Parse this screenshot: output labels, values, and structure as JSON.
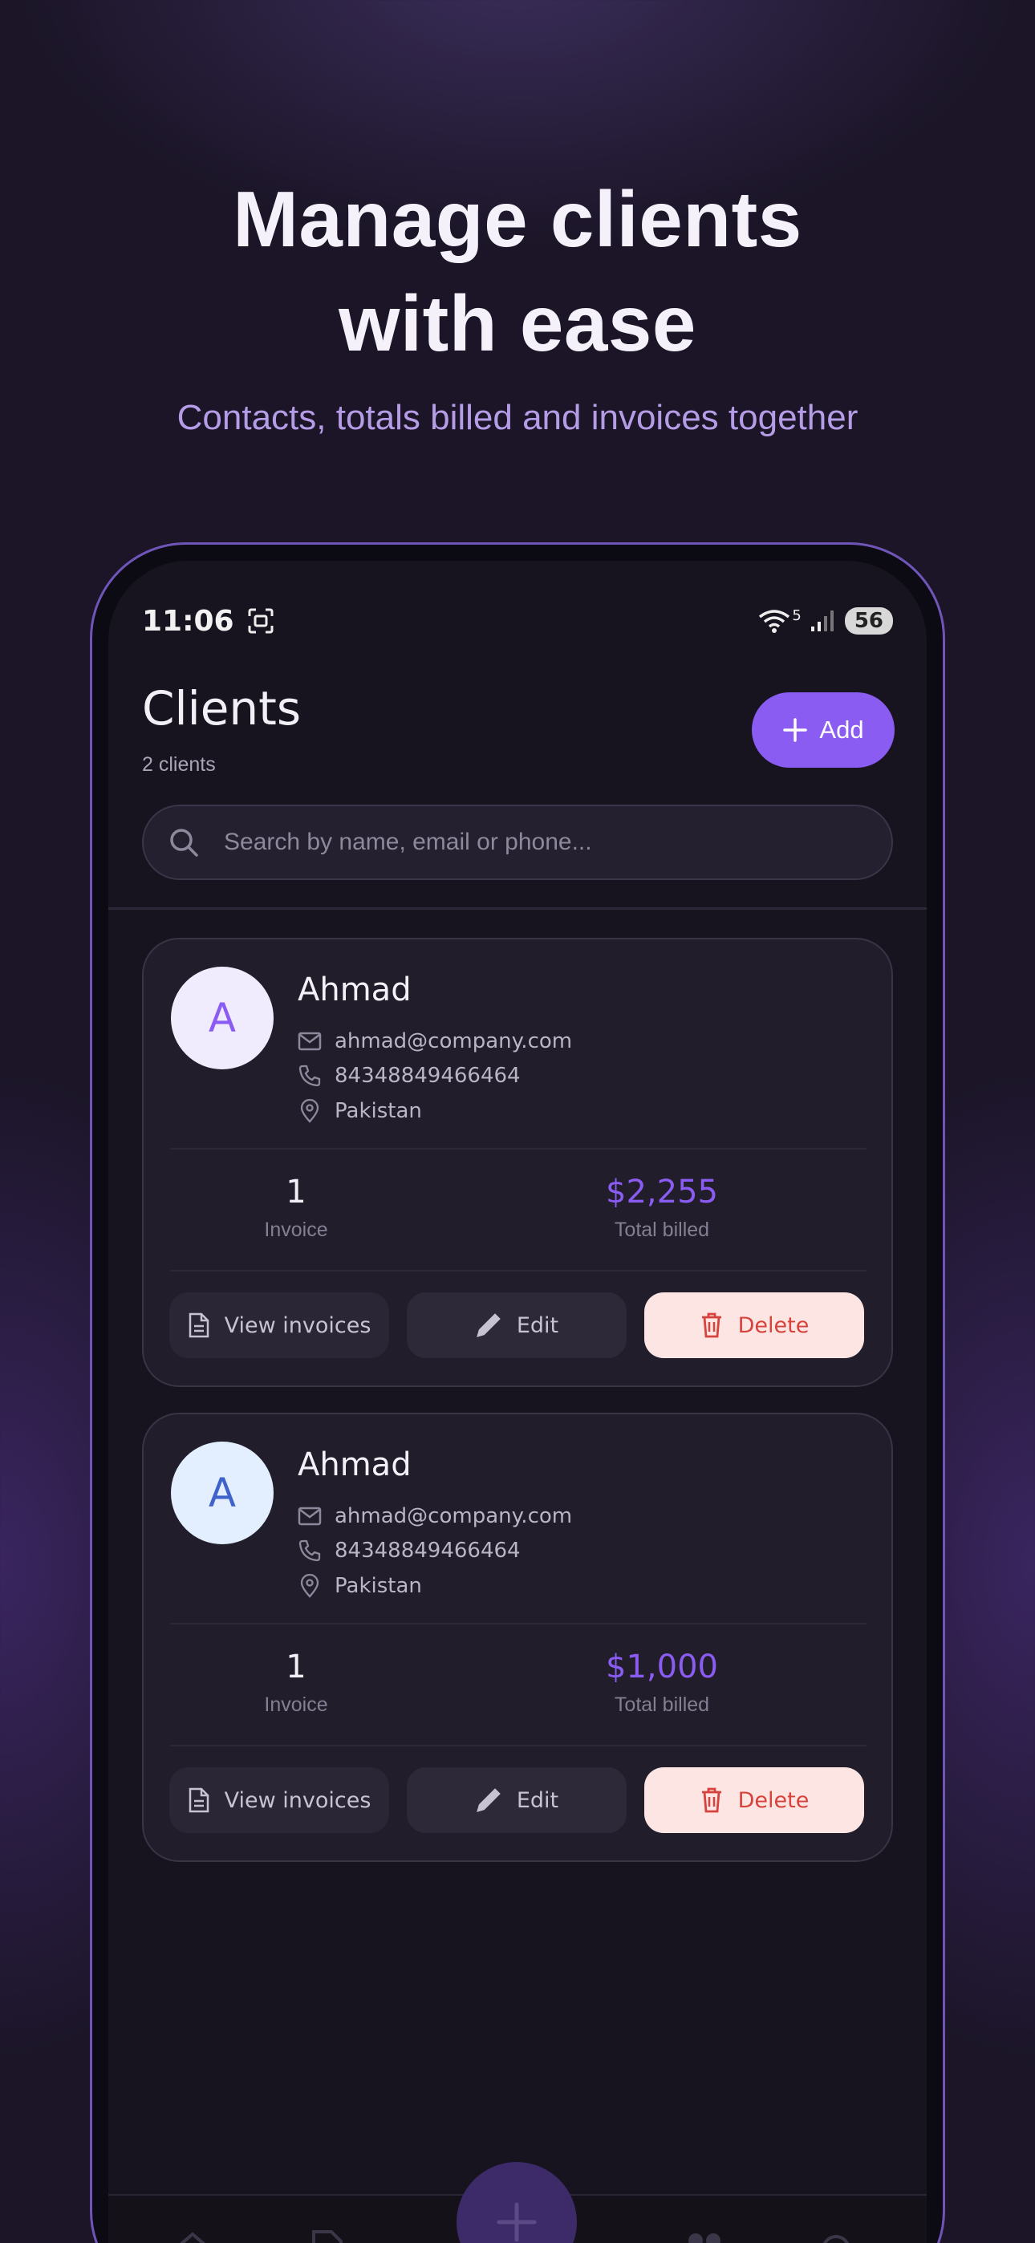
{
  "hero": {
    "title_line1": "Manage clients",
    "title_line2": "with ease",
    "subtitle": "Contacts, totals billed and invoices together"
  },
  "status_bar": {
    "time": "11:06",
    "battery": "56",
    "wifi_badge": "5"
  },
  "header": {
    "title": "Clients",
    "count": "2 clients",
    "add_label": "Add"
  },
  "search": {
    "placeholder": "Search by name, email or phone..."
  },
  "clients": [
    {
      "initial": "A",
      "name": "Ahmad",
      "email": "ahmad@company.com",
      "phone": "84348849466464",
      "country": "Pakistan",
      "invoice_count": "1",
      "invoice_label": "Invoice",
      "total_billed": "$2,255",
      "total_label": "Total billed",
      "avatar_bg": "#f1ecfd",
      "avatar_fg": "#8a5cf2"
    },
    {
      "initial": "A",
      "name": "Ahmad",
      "email": "ahmad@company.com",
      "phone": "84348849466464",
      "country": "Pakistan",
      "invoice_count": "1",
      "invoice_label": "Invoice",
      "total_billed": "$1,000",
      "total_label": "Total billed",
      "avatar_bg": "#e3efff",
      "avatar_fg": "#3f63c9"
    }
  ],
  "actions": {
    "view_invoices": "View invoices",
    "edit": "Edit",
    "delete": "Delete"
  },
  "colors": {
    "accent": "#8a5cf2",
    "delete_bg": "#fde5e3",
    "delete_fg": "#d6423c"
  }
}
